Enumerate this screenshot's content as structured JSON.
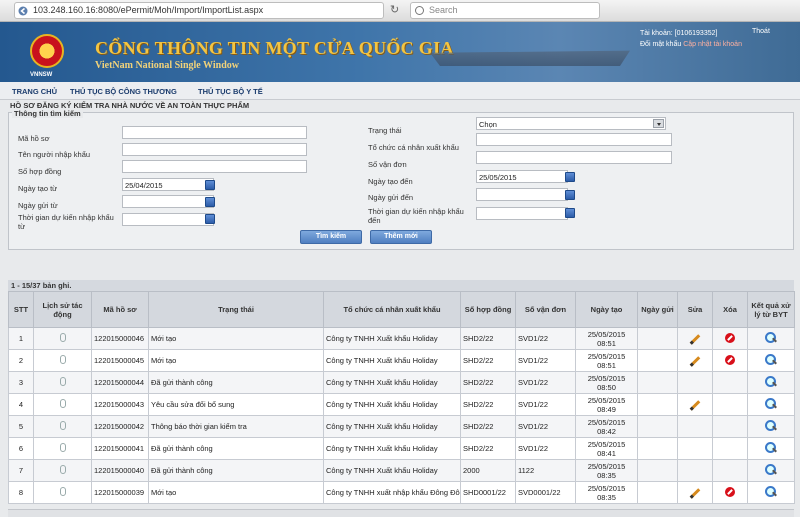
{
  "browser": {
    "url": "103.248.160.16:8080/ePermit/Moh/Import/ImportList.aspx",
    "search_placeholder": "Search"
  },
  "header": {
    "title": "CỔNG THÔNG TIN MỘT CỬA QUỐC GIA",
    "subtitle": "VietNam National Single Window",
    "logo_text": "VNNSW",
    "account_label": "Tài khoản: [0106193352]",
    "change_password": "Đổi mật khẩu",
    "update_info": "Cập nhật tài khoản",
    "logout": "Thoát"
  },
  "menu": [
    "TRANG CHỦ",
    "THỦ TỤC BỘ CÔNG THƯƠNG",
    "THỦ TỤC BỘ Y TẾ"
  ],
  "page_title": "HỒ SƠ ĐĂNG KÝ KIỂM TRA NHÀ NƯỚC VỀ AN TOÀN THỰC PHẨM",
  "search": {
    "legend": "Thông tin tìm kiếm",
    "labels": {
      "ma_ho_so": "Mã hồ sơ",
      "nguoi_nhap_khau": "Tên người nhập khẩu",
      "so_hop_dong": "Số hợp đồng",
      "ngay_tao_tu": "Ngày tạo từ",
      "ngay_gui_tu": "Ngày gửi từ",
      "thoi_gian_tu": "Thời gian dự kiến nhập khẩu từ",
      "trang_thai": "Trạng thái",
      "to_chuc": "Tổ chức cá nhân xuất khẩu",
      "so_van_don": "Số vận đơn",
      "ngay_tao_den": "Ngày tạo đến",
      "ngay_gui_den": "Ngày gửi đến",
      "thoi_gian_den": "Thời gian dự kiến nhập khẩu đến"
    },
    "values": {
      "ngay_tao_tu": "25/04/2015",
      "trang_thai": "Chọn",
      "ngay_tao_den": "25/05/2015"
    },
    "search_button": "Tìm kiếm",
    "add_button": "Thêm mới"
  },
  "table": {
    "count_text": "1 - 15/37 bản ghi.",
    "headers": {
      "stt": "STT",
      "lich_su": "Lịch sử tác động",
      "ma_ho_so": "Mã hồ sơ",
      "trang_thai": "Trạng thái",
      "to_chuc": "Tổ chức cá nhân xuất khẩu",
      "so_hop_dong": "Số hợp đồng",
      "so_van_don": "Số vận đơn",
      "ngay_tao": "Ngày tạo",
      "ngay_gui": "Ngày gửi",
      "sua": "Sửa",
      "xoa": "Xóa",
      "ket_qua": "Kết quả xử lý từ BYT"
    },
    "rows": [
      {
        "stt": "1",
        "ma": "122015000046",
        "status": "Mới tạo",
        "org": "Công ty TNHH Xuất khẩu Holiday",
        "hd": "SHD2/22",
        "vd": "SVD1/22",
        "date": "25/05/2015",
        "time": "08:51",
        "edit": true,
        "del": true
      },
      {
        "stt": "2",
        "ma": "122015000045",
        "status": "Mới tạo",
        "org": "Công ty TNHH Xuất khẩu Holiday",
        "hd": "SHD2/22",
        "vd": "SVD1/22",
        "date": "25/05/2015",
        "time": "08:51",
        "edit": true,
        "del": true
      },
      {
        "stt": "3",
        "ma": "122015000044",
        "status": "Đã gửi thành công",
        "org": "Công ty TNHH Xuất khẩu Holiday",
        "hd": "SHD2/22",
        "vd": "SVD1/22",
        "date": "25/05/2015",
        "time": "08:50",
        "edit": false,
        "del": false
      },
      {
        "stt": "4",
        "ma": "122015000043",
        "status": "Yêu cầu sửa đổi bổ sung",
        "org": "Công ty TNHH Xuất khẩu Holiday",
        "hd": "SHD2/22",
        "vd": "SVD1/22",
        "date": "25/05/2015",
        "time": "08:49",
        "edit": true,
        "del": false
      },
      {
        "stt": "5",
        "ma": "122015000042",
        "status": "Thông báo thời gian kiểm tra",
        "org": "Công ty TNHH Xuất khẩu Holiday",
        "hd": "SHD2/22",
        "vd": "SVD1/22",
        "date": "25/05/2015",
        "time": "08:42",
        "edit": false,
        "del": false
      },
      {
        "stt": "6",
        "ma": "122015000041",
        "status": "Đã gửi thành công",
        "org": "Công ty TNHH Xuất khẩu Holiday",
        "hd": "SHD2/22",
        "vd": "SVD1/22",
        "date": "25/05/2015",
        "time": "08:41",
        "edit": false,
        "del": false
      },
      {
        "stt": "7",
        "ma": "122015000040",
        "status": "Đã gửi thành công",
        "org": "Công ty TNHH Xuất khẩu Holiday",
        "hd": "2000",
        "vd": "1122",
        "date": "25/05/2015",
        "time": "08:35",
        "edit": false,
        "del": false
      },
      {
        "stt": "8",
        "ma": "122015000039",
        "status": "Mới tạo",
        "org": "Công ty TNHH xuất nhập khẩu Đông Đô",
        "hd": "SHD0001/22",
        "vd": "SVD0001/22",
        "date": "25/05/2015",
        "time": "08:35",
        "edit": true,
        "del": true
      }
    ]
  }
}
